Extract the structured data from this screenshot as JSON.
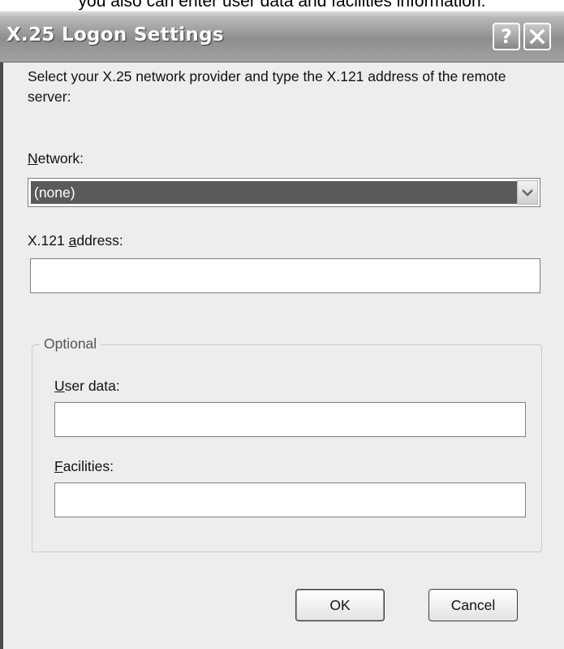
{
  "background_caption": "you also can enter user data and facilities information.",
  "dialog": {
    "title": "X.25 Logon Settings",
    "help_button": "?",
    "close_button": "X"
  },
  "description": "Select your X.25 network provider and type the X.121 address of the remote server:",
  "network": {
    "label_mnemonic": "N",
    "label_rest": "etwork:",
    "selected": "(none)",
    "arrow_icon": "chevron-down-icon"
  },
  "x121": {
    "label_prefix": "X.121 ",
    "label_mnemonic": "a",
    "label_rest": "ddress:",
    "value": ""
  },
  "optional": {
    "legend": "Optional",
    "user_data_mnemonic": "U",
    "user_data_rest": "ser data:",
    "user_data_value": "",
    "facilities_mnemonic": "F",
    "facilities_rest": "acilities:",
    "facilities_value": ""
  },
  "buttons": {
    "ok": "OK",
    "cancel": "Cancel"
  }
}
